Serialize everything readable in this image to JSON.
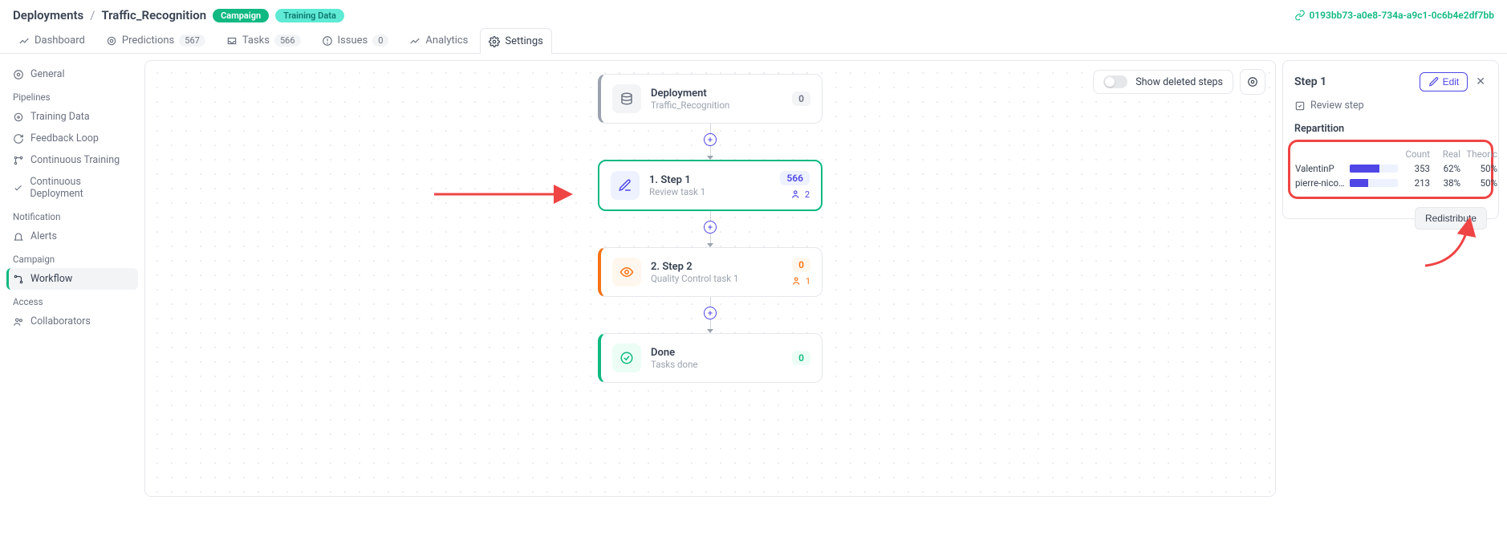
{
  "breadcrumb": {
    "root": "Deployments",
    "name": "Traffic_Recognition"
  },
  "badges": {
    "campaign": "Campaign",
    "training": "Training Data"
  },
  "deploy_id": "0193bb73-a0e8-734a-a9c1-0c6b4e2df7bb",
  "tabs": {
    "dashboard": "Dashboard",
    "predictions": "Predictions",
    "predictions_count": "567",
    "tasks": "Tasks",
    "tasks_count": "566",
    "issues": "Issues",
    "issues_count": "0",
    "analytics": "Analytics",
    "settings": "Settings"
  },
  "sidebar": {
    "general": "General",
    "pipelines_h": "Pipelines",
    "training_data": "Training Data",
    "feedback_loop": "Feedback Loop",
    "continuous_training": "Continuous Training",
    "continuous_deployment": "Continuous Deployment",
    "notification_h": "Notification",
    "alerts": "Alerts",
    "campaign_h": "Campaign",
    "workflow": "Workflow",
    "access_h": "Access",
    "collaborators": "Collaborators"
  },
  "canvas": {
    "toggle_label": "Show deleted steps",
    "deployment": {
      "title": "Deployment",
      "sub": "Traffic_Recognition",
      "count": "0"
    },
    "step1": {
      "title": "1. Step 1",
      "sub": "Review task 1",
      "count": "566",
      "people": "2"
    },
    "step2": {
      "title": "2. Step 2",
      "sub": "Quality Control task 1",
      "count": "0",
      "people": "1"
    },
    "done": {
      "title": "Done",
      "sub": "Tasks done",
      "count": "0"
    }
  },
  "panel": {
    "title": "Step 1",
    "edit": "Edit",
    "review_step": "Review step",
    "repartition_h": "Repartition",
    "headers": {
      "count": "Count",
      "real": "Real",
      "theoric": "Theoric"
    },
    "rows": [
      {
        "name": "ValentinP",
        "count": "353",
        "real": "62%",
        "theoric": "50%",
        "pct": 62
      },
      {
        "name": "pierre-nicolas",
        "count": "213",
        "real": "38%",
        "theoric": "50%",
        "pct": 38
      }
    ],
    "redistribute": "Redistribute"
  }
}
